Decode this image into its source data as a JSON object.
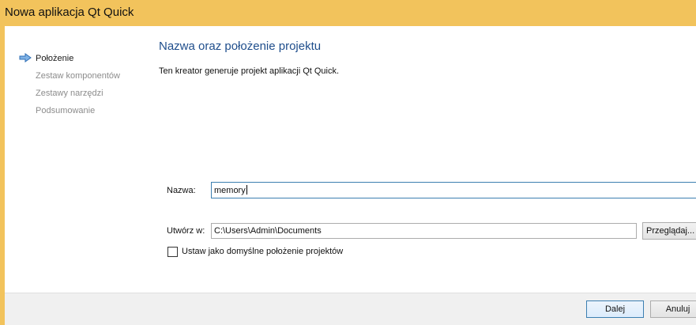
{
  "window": {
    "title": "Nowa aplikacja Qt Quick"
  },
  "sidebar": {
    "items": [
      {
        "label": "Położenie",
        "active": true
      },
      {
        "label": "Zestaw komponentów",
        "active": false
      },
      {
        "label": "Zestawy narzędzi",
        "active": false
      },
      {
        "label": "Podsumowanie",
        "active": false
      }
    ],
    "active_icon": "arrow-right-icon"
  },
  "main": {
    "title": "Nazwa oraz położenie projektu",
    "description": "Ten kreator generuje projekt aplikacji Qt Quick.",
    "name_label": "Nazwa:",
    "name_value": "memory",
    "create_in_label": "Utwórz w:",
    "create_in_value": "C:\\Users\\Admin\\Documents",
    "browse_label": "Przeglądaj...",
    "default_checkbox_label": "Ustaw jako domyślne położenie projektów",
    "default_checkbox_checked": false
  },
  "footer": {
    "next_label": "Dalej",
    "cancel_label": "Anuluj"
  },
  "colors": {
    "titlebar": "#f2c35c",
    "accent": "#3c7fb1",
    "heading": "#1f4e8c"
  }
}
